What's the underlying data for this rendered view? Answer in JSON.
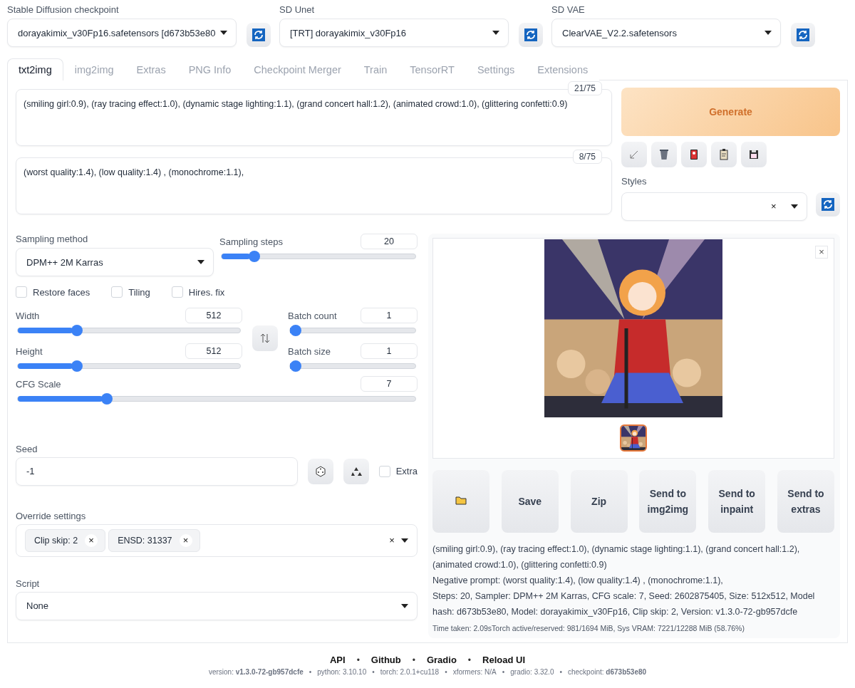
{
  "model_bar": [
    {
      "label": "Stable Diffusion checkpoint",
      "value": "dorayakimix_v30Fp16.safetensors [d673b53e80"
    },
    {
      "label": "SD Unet",
      "value": "[TRT] dorayakimix_v30Fp16"
    },
    {
      "label": "SD VAE",
      "value": "ClearVAE_V2.2.safetensors"
    }
  ],
  "tabs": [
    {
      "label": "txt2img",
      "selected": true
    },
    {
      "label": "img2img",
      "selected": false
    },
    {
      "label": "Extras",
      "selected": false
    },
    {
      "label": "PNG Info",
      "selected": false
    },
    {
      "label": "Checkpoint Merger",
      "selected": false
    },
    {
      "label": "Train",
      "selected": false
    },
    {
      "label": "TensorRT",
      "selected": false
    },
    {
      "label": "Settings",
      "selected": false
    },
    {
      "label": "Extensions",
      "selected": false
    }
  ],
  "prompts": [
    {
      "value": "(smiling girl:0.9), (ray tracing effect:1.0), (dynamic stage lighting:1.1), (grand concert hall:1.2), (animated crowd:1.0), (glittering confetti:0.9)",
      "counter": "21/75"
    },
    {
      "value": "(worst quality:1.4), (low quality:1.4) , (monochrome:1.1),",
      "counter": "8/75"
    }
  ],
  "generate": "Generate",
  "styles": {
    "label": "Styles",
    "clear": "×"
  },
  "sampling_method": {
    "label": "Sampling method",
    "value": "DPM++ 2M Karras"
  },
  "sampling_steps": {
    "label": "Sampling steps",
    "value": "20",
    "level": 0.14
  },
  "checkboxes": [
    {
      "label": "Restore faces",
      "checked": false
    },
    {
      "label": "Tiling",
      "checked": false
    },
    {
      "label": "Hires. fix",
      "checked": false
    }
  ],
  "size_sliders": [
    {
      "label": "Width",
      "value": "512",
      "level": 0.24
    },
    {
      "label": "Height",
      "value": "512",
      "level": 0.24
    }
  ],
  "batch_sliders": [
    {
      "label": "Batch count",
      "value": "1",
      "level": 0
    },
    {
      "label": "Batch size",
      "value": "1",
      "level": 0
    }
  ],
  "cfg_scale": {
    "label": "CFG Scale",
    "value": "7",
    "level": 0.21
  },
  "seed": {
    "label": "Seed",
    "value": "-1",
    "extra": {
      "label": "Extra",
      "checked": false
    }
  },
  "override": {
    "label": "Override settings",
    "tags": [
      {
        "label": "Clip skip: 2",
        "remove": "×"
      },
      {
        "label": "ENSD: 31337",
        "remove": "×"
      }
    ],
    "clear": "×"
  },
  "script": {
    "label": "Script",
    "value": "None"
  },
  "result": {
    "close": "×",
    "actions": [
      {
        "kind": "icon"
      },
      {
        "kind": "text",
        "label": "Save"
      },
      {
        "kind": "text",
        "label": "Zip"
      },
      {
        "kind": "text",
        "label": "Send to img2img"
      },
      {
        "kind": "text",
        "label": "Send to inpaint"
      },
      {
        "kind": "text",
        "label": "Send to extras"
      }
    ],
    "info": [
      "(smiling girl:0.9), (ray tracing effect:1.0), (dynamic stage lighting:1.1), (grand concert hall:1.2), (animated crowd:1.0), (glittering confetti:0.9)",
      "Negative prompt: (worst quality:1.4), (low quality:1.4) , (monochrome:1.1),",
      "Steps: 20, Sampler: DPM++ 2M Karras, CFG scale: 7, Seed: 2602875405, Size: 512x512, Model hash: d673b53e80, Model: dorayakimix_v30Fp16, Clip skip: 2, Version: v1.3.0-72-gb957dcfe"
    ],
    "timing": "Time taken: 2.09sTorch active/reserved: 981/1694 MiB, Sys VRAM: 7221/12288 MiB (58.76%)"
  },
  "footer": {
    "separator": "•",
    "links": [
      "API",
      "Github",
      "Gradio",
      "Reload UI"
    ],
    "versions": [
      "version: **v1.3.0-72-gb957dcfe**",
      "python: 3.10.10",
      "torch: 2.0.1+cu118",
      "xformers: N/A",
      "gradio: 3.32.0",
      "checkpoint: **d673b53e80**"
    ]
  }
}
